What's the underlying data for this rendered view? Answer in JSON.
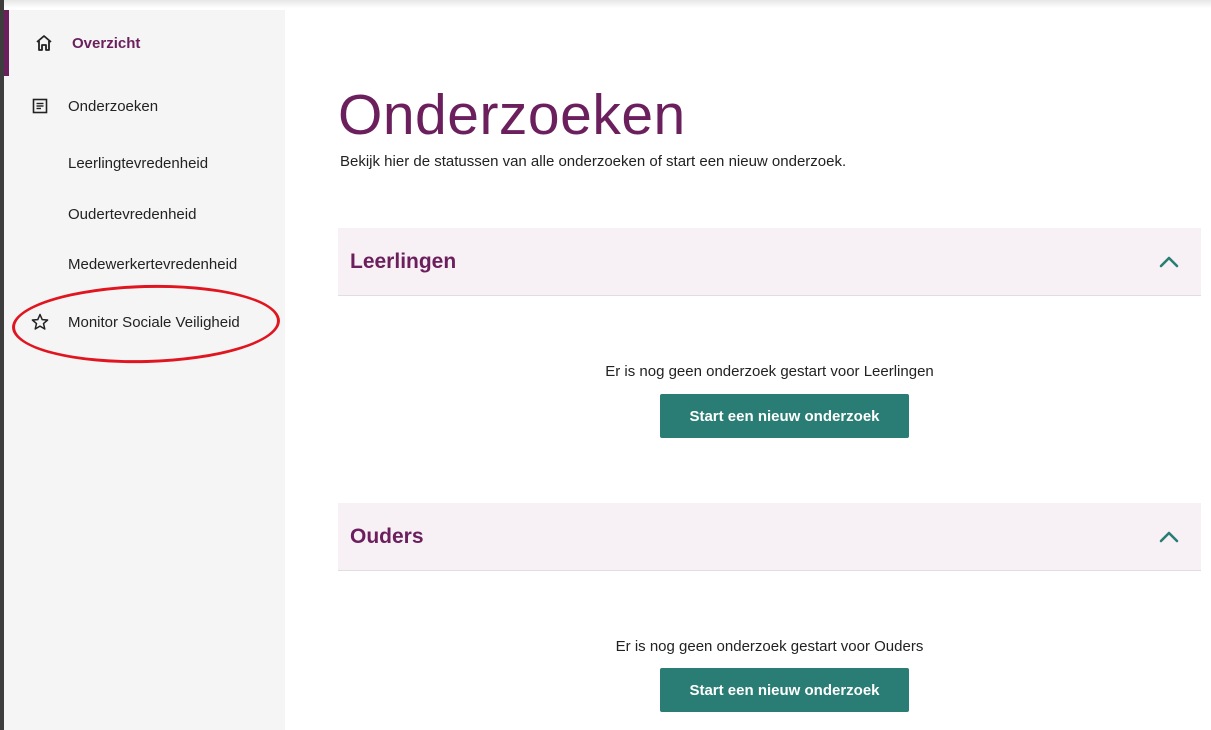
{
  "sidebar": {
    "items": [
      {
        "label": "Overzicht",
        "icon": "home-icon"
      },
      {
        "label": "Onderzoeken",
        "icon": "document-icon"
      },
      {
        "label": "Leerlingtevredenheid"
      },
      {
        "label": "Oudertevredenheid"
      },
      {
        "label": "Medewerkertevredenheid"
      },
      {
        "label": "Monitor Sociale Veiligheid",
        "icon": "star-icon"
      }
    ]
  },
  "main": {
    "title": "Onderzoeken",
    "subtitle": "Bekijk hier de statussen van alle onderzoeken of start een nieuw onderzoek.",
    "sections": [
      {
        "title": "Leerlingen",
        "empty_text": "Er is nog geen onderzoek gestart voor Leerlingen",
        "button_label": "Start een nieuw onderzoek"
      },
      {
        "title": "Ouders",
        "empty_text": "Er is nog geen onderzoek gestart voor Ouders",
        "button_label": "Start een nieuw onderzoek"
      }
    ]
  },
  "colors": {
    "brand": "#6b1f5c",
    "button": "#2a7d74",
    "annotation": "#e0151f"
  }
}
